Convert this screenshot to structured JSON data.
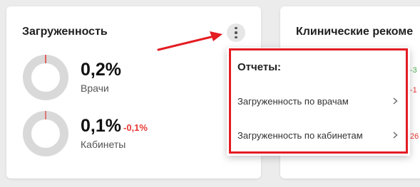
{
  "colors": {
    "accent": "#e41c23",
    "donut_track": "#d9d9d9",
    "donut_fill": "#e53935",
    "delta_negative": "#e53935"
  },
  "load_card": {
    "title": "Загруженность",
    "menu_icon": "kebab-icon",
    "metrics": [
      {
        "value": "0,2%",
        "label": "Врачи",
        "delta": "",
        "fraction": 0.002
      },
      {
        "value": "0,1%",
        "label": "Кабинеты",
        "delta": "-0,1%",
        "fraction": 0.001
      }
    ]
  },
  "clinical_card": {
    "title": "Клинические рекоме",
    "side_values": [
      "-3",
      "-1",
      "26"
    ]
  },
  "menu": {
    "heading": "Отчеты:",
    "items": [
      {
        "label": "Загруженность по врачам",
        "icon": "chevron-right-icon"
      },
      {
        "label": "Загруженность по кабинетам",
        "icon": "chevron-right-icon"
      }
    ]
  }
}
